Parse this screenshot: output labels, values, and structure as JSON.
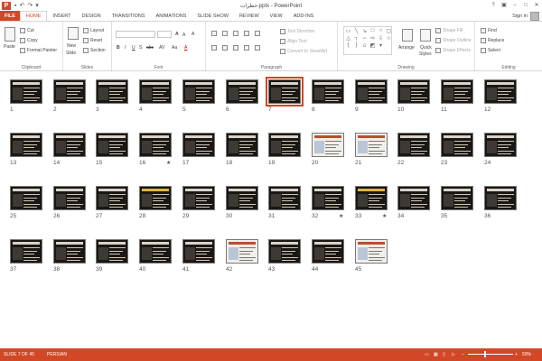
{
  "window": {
    "title": "خطرات.pptx - PowerPoint",
    "help": "?",
    "restore_icon": "restore-icon",
    "minimize": "–",
    "maximize": "□",
    "close": "✕"
  },
  "qat": {
    "save": "▪",
    "undo": "↶",
    "redo": "↷",
    "customize": "▾"
  },
  "tabs": [
    "FILE",
    "HOME",
    "INSERT",
    "DESIGN",
    "TRANSITIONS",
    "ANIMATIONS",
    "SLIDE SHOW",
    "REVIEW",
    "VIEW",
    "ADD-INS"
  ],
  "active_tab": "HOME",
  "account": {
    "sign_in": "Sign in"
  },
  "ribbon": {
    "clipboard": {
      "label": "Clipboard",
      "paste": "Paste",
      "cut": "Cut",
      "copy": "Copy",
      "format_painter": "Format Painter"
    },
    "slides": {
      "label": "Slides",
      "new_slide": "New",
      "new_slide2": "Slide",
      "layout": "Layout",
      "reset": "Reset",
      "section": "Section"
    },
    "font": {
      "label": "Font",
      "bold": "B",
      "italic": "I",
      "underline": "U",
      "shadow": "S",
      "strike": "abc",
      "spacing": "AV",
      "case": "Aa",
      "color": "A",
      "grow": "A",
      "shrink": "A",
      "clear": "A"
    },
    "paragraph": {
      "label": "Paragraph",
      "text_direction": "Text Direction",
      "align_text": "Align Text",
      "convert_smartart": "Convert to SmartArt"
    },
    "drawing": {
      "label": "Drawing",
      "arrange": "Arrange",
      "quick_styles": "Quick",
      "quick_styles2": "Styles",
      "shape_fill": "Shape Fill",
      "shape_outline": "Shape Outline",
      "shape_effects": "Shape Effects"
    },
    "editing": {
      "label": "Editing",
      "find": "Find",
      "replace": "Replace",
      "select": "Select"
    }
  },
  "slides": {
    "count": 45,
    "selected": 7,
    "starred": [
      16,
      32,
      33
    ],
    "star_symbol": "★",
    "light": [
      20,
      21,
      42,
      45
    ],
    "yellow": [
      28,
      33
    ]
  },
  "statusbar": {
    "slide_info": "SLIDE 7 OF 45",
    "language": "PERSIAN",
    "zoom": "50%",
    "zoom_minus": "–",
    "zoom_plus": "+"
  }
}
